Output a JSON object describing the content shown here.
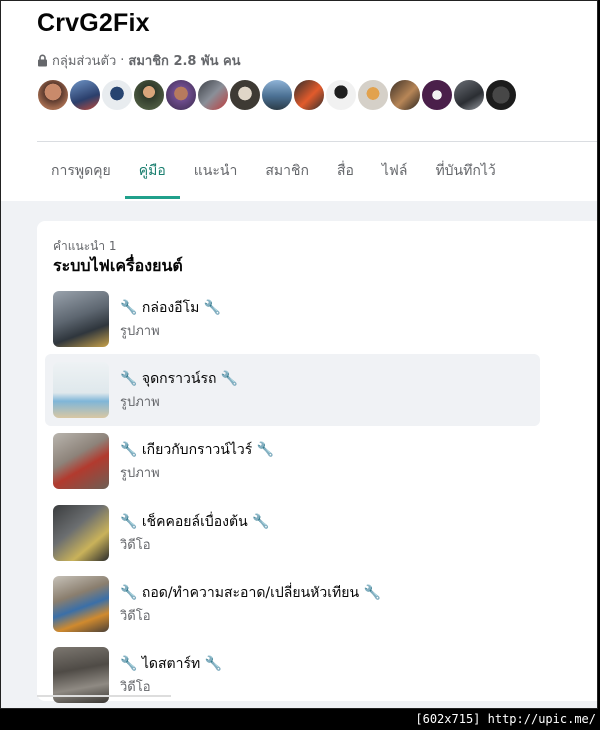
{
  "group": {
    "name": "CrvG2Fix",
    "privacy": "กลุ่มส่วนตัว",
    "separator": "·",
    "members": "สมาชิก 2.8 พัน คน"
  },
  "tabs": [
    {
      "label": "การพูดคุย"
    },
    {
      "label": "คู่มือ"
    },
    {
      "label": "แนะนำ"
    },
    {
      "label": "สมาชิก"
    },
    {
      "label": "สื่อ"
    },
    {
      "label": "ไฟล์"
    },
    {
      "label": "ที่บันทึกไว้"
    }
  ],
  "guide": {
    "kicker": "คำแนะนำ 1",
    "title": "ระบบไฟเครื่องยนต์",
    "items": [
      {
        "title": "🔧 กล่องอีโม 🔧",
        "type": "รูปภาพ"
      },
      {
        "title": "🔧 จุดกราวน์รถ 🔧",
        "type": "รูปภาพ"
      },
      {
        "title": "🔧 เกียวกับกราวน์ไวร์ 🔧",
        "type": "รูปภาพ"
      },
      {
        "title": "🔧 เช็คคอยล์เบื่องต้น 🔧",
        "type": "วิดีโอ"
      },
      {
        "title": "🔧 ถอด/ทำความสะอาด/เปลี่ยนหัวเทียน 🔧",
        "type": "วิดีโอ"
      },
      {
        "title": "🔧 ไดสตาร์ท 🔧",
        "type": "วิดีโอ"
      }
    ]
  },
  "watermark": "[602x715] http://upic.me/",
  "colors": {
    "accent": "#20a08b",
    "muted": "#65676b",
    "surface": "#f0f2f5"
  }
}
